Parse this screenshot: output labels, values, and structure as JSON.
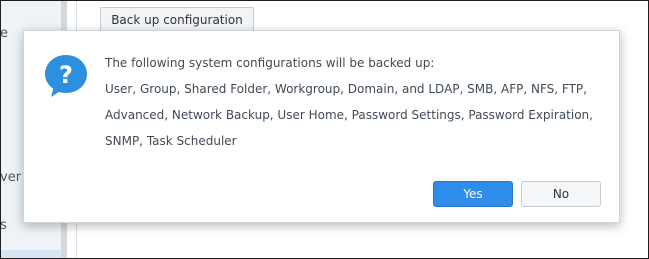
{
  "background": {
    "button_label": "Back up configuration",
    "sidebar_fragments": [
      "e",
      "ver",
      "s"
    ]
  },
  "dialog": {
    "icon": "question-icon",
    "lines": [
      "The following system configurations will be backed up:",
      "User, Group, Shared Folder, Workgroup, Domain, and LDAP, SMB, AFP, NFS, FTP,",
      "Advanced, Network Backup, User Home, Password Settings, Password Expiration,",
      "SNMP, Task Scheduler"
    ],
    "yes_label": "Yes",
    "no_label": "No"
  },
  "colors": {
    "primary_button": "#2f8ce8",
    "icon_blue": "#2d8fe0"
  }
}
